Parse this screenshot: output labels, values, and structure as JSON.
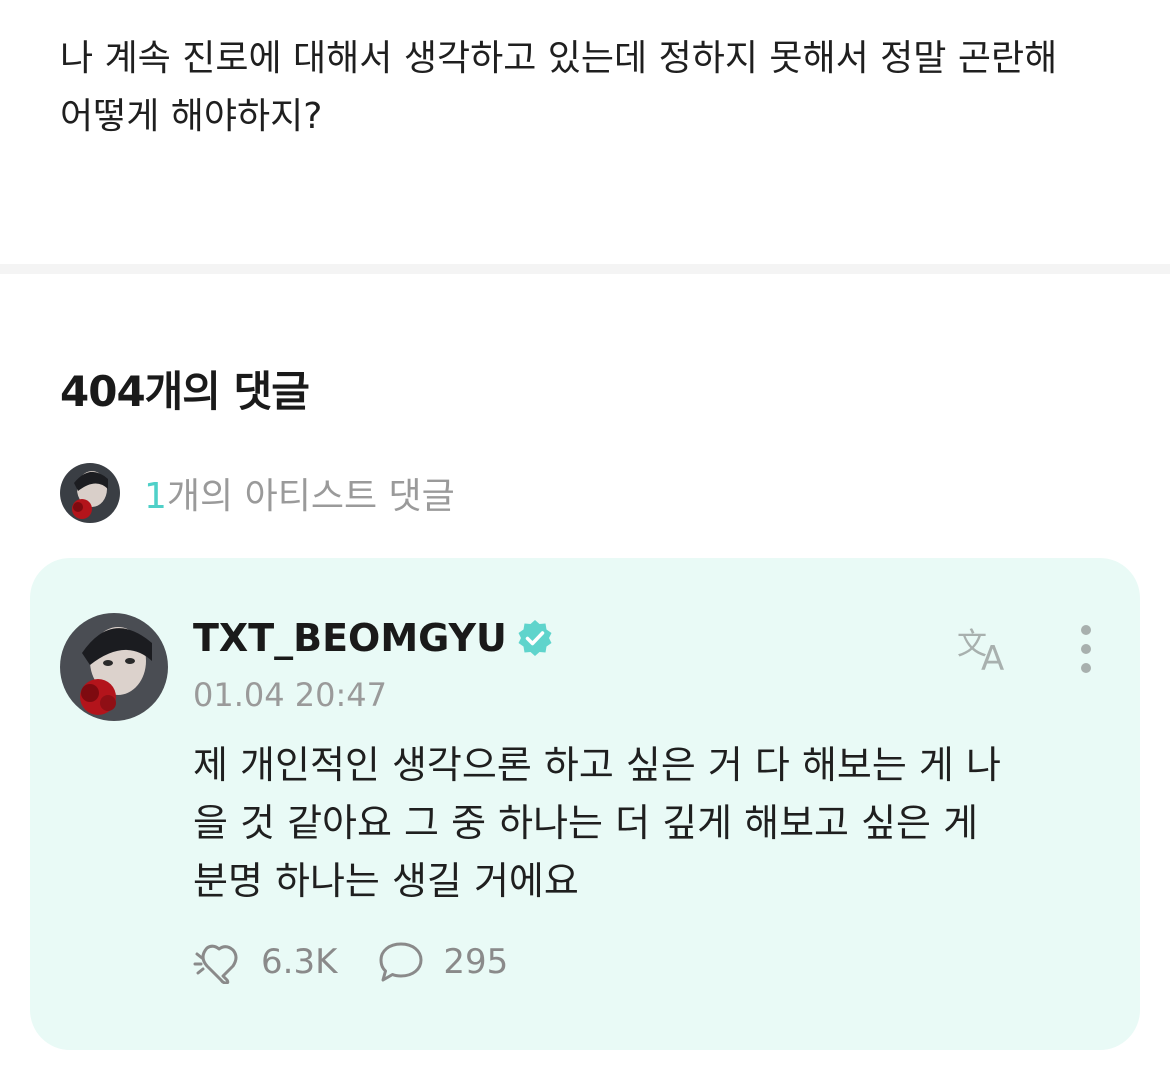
{
  "post": {
    "text": "나 계속 진로에 대해서 생각하고 있는데 정하지 못해서 정말 곤란해\n어떻게 해야하지?"
  },
  "comments_section": {
    "title": "404개의 댓글",
    "artist_count": "1",
    "artist_label": "개의 아티스트 댓글"
  },
  "comment": {
    "username": "TXT_BEOMGYU",
    "timestamp": "01.04 20:47",
    "text": "제 개인적인 생각으론 하고 싶은 거 다 해보는 게 나\n을 것 같아요 그 중 하나는 더 깊게 해보고 싶은 게\n분명 하나는 생길 거에요",
    "likes": "6.3K",
    "replies": "295"
  },
  "colors": {
    "accent": "#4fd0c8",
    "card_background": "#e9faf6",
    "muted_text": "#9a9a9a"
  },
  "icons": {
    "verified": "verified-badge-icon",
    "translate": "translate-icon",
    "more": "more-vertical-icon",
    "like": "like-icon",
    "reply": "comment-bubble-icon"
  }
}
